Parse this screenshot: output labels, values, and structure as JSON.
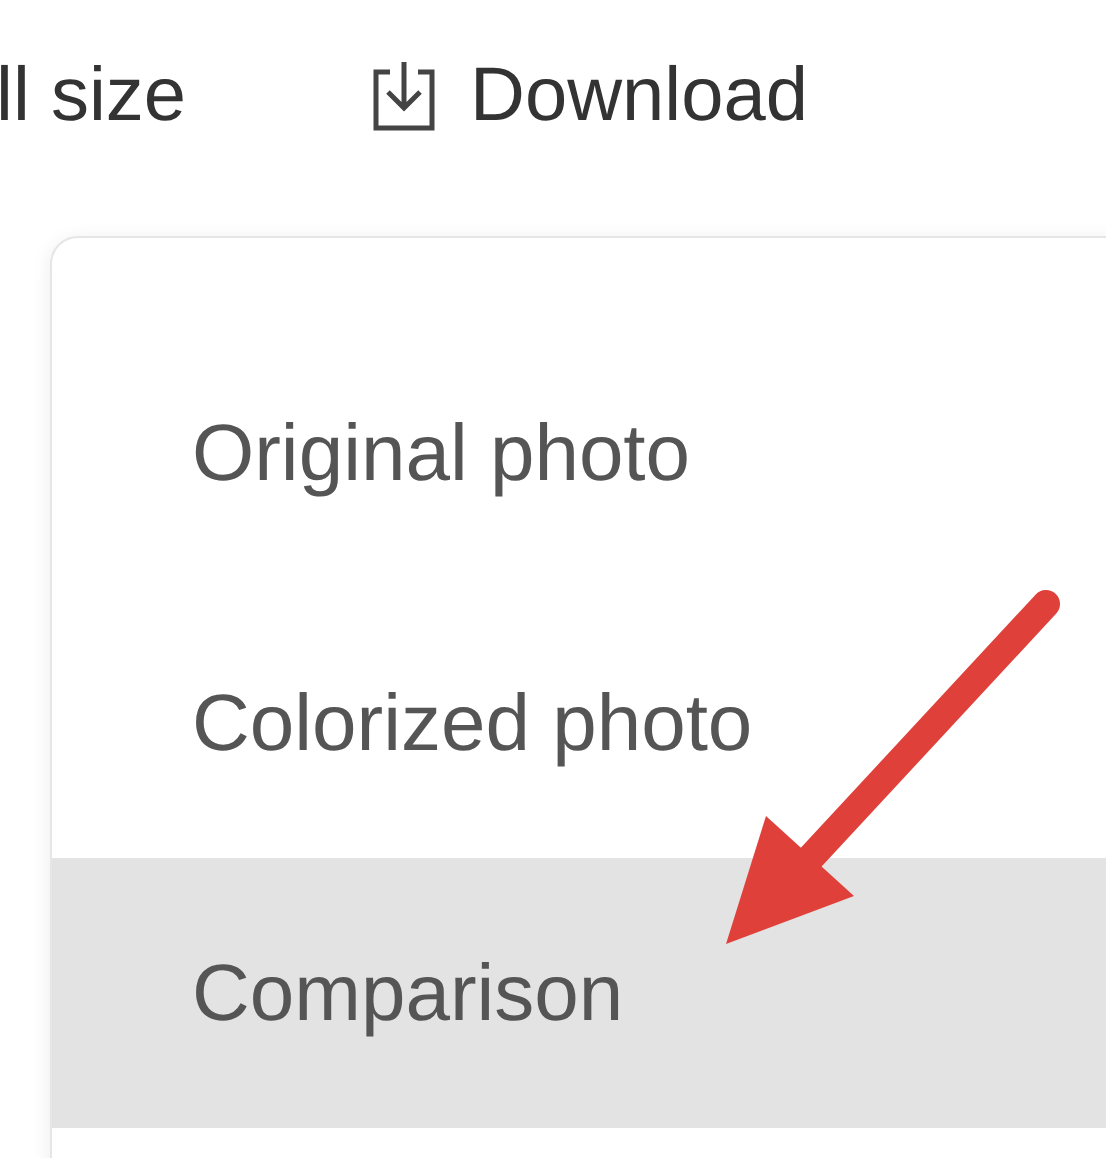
{
  "toolbar": [
    {
      "kind": "text",
      "label": "ll size"
    },
    {
      "kind": "download",
      "label": "Download"
    }
  ],
  "menu": {
    "items": [
      {
        "label": "Original photo",
        "selected": false
      },
      {
        "label": "Colorized photo",
        "selected": false
      },
      {
        "label": "Comparison",
        "selected": true
      }
    ]
  }
}
